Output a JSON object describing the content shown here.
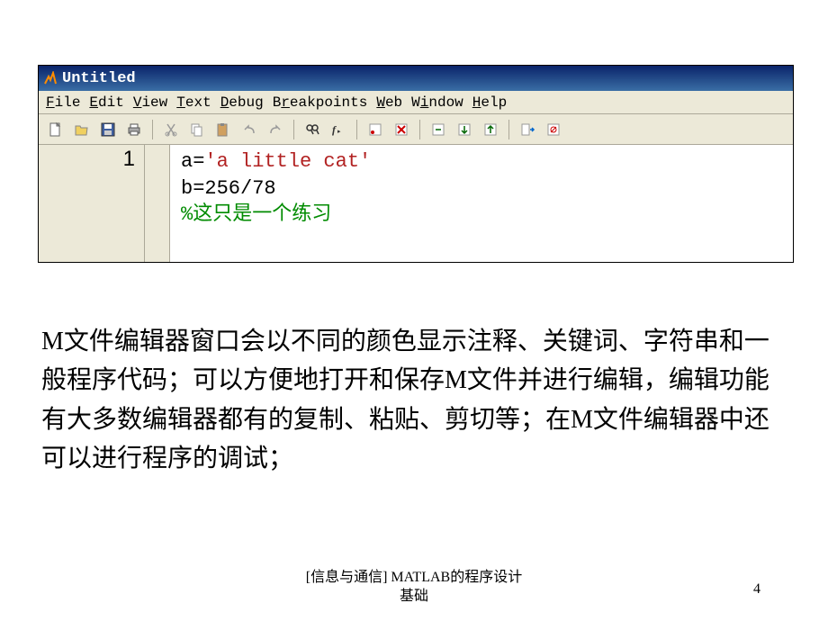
{
  "window": {
    "title": "Untitled"
  },
  "menu": {
    "file": "File",
    "edit": "Edit",
    "view": "View",
    "text": "Text",
    "debug": "Debug",
    "breakpoints": "Breakpoints",
    "web": "Web",
    "window": "Window",
    "help": "Help"
  },
  "gutter": {
    "line1": "1"
  },
  "code": {
    "line1_a": "a=",
    "line1_b": "'a little cat'",
    "line2": "b=256/78",
    "line3": "%这只是一个练习"
  },
  "body_text": "M文件编辑器窗口会以不同的颜色显示注释、关键词、字符串和一般程序代码；可以方便地打开和保存M文件并进行编辑，编辑功能有大多数编辑器都有的复制、粘贴、剪切等；在M文件编辑器中还可以进行程序的调试；",
  "footer": {
    "line1": "[信息与通信] MATLAB的程序设计",
    "line2": "基础",
    "page": "4"
  }
}
